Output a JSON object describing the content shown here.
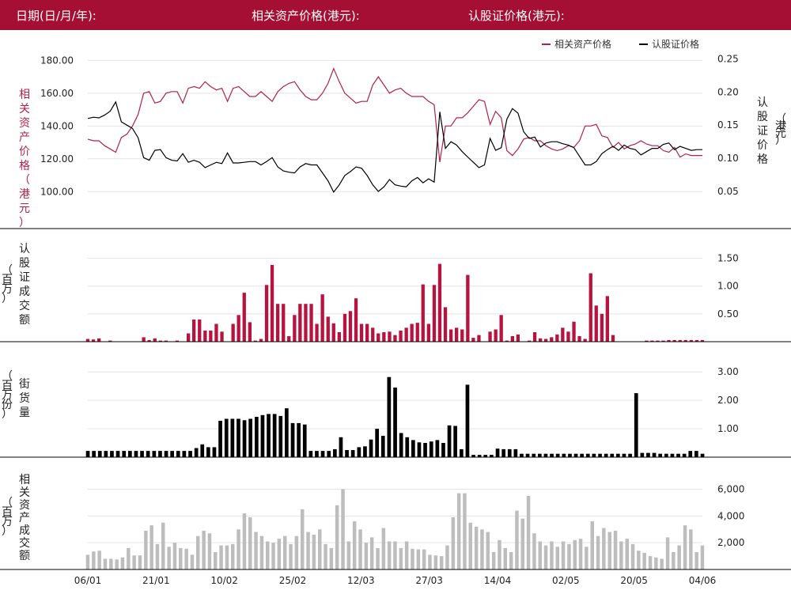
{
  "header": {
    "date_label": "日期(日/月/年):",
    "underlying_label": "相关资产价格(港元):",
    "warrant_label": "认股证价格(港元):"
  },
  "colors": {
    "brand": "#a50f33",
    "underlying": "#b0224a",
    "warrant": "#000000",
    "warrant_bar": "#b8123e",
    "outstanding_bar": "#000000",
    "turnover_bar": "#bdbdbd"
  },
  "chart_data": [
    {
      "type": "line",
      "x_tick_labels": [
        "06/01",
        "21/01",
        "10/02",
        "25/02",
        "12/03",
        "27/03",
        "14/04",
        "02/05",
        "20/05",
        "04/06"
      ],
      "left_axis_title": "相关资产价格（港元）",
      "right_axis_title": "认股证价格（港元）",
      "left_ticks": [
        "100.00",
        "120.00",
        "140.00",
        "160.00",
        "180.00"
      ],
      "right_ticks": [
        "0.05",
        "0.10",
        "0.15",
        "0.20",
        "0.25"
      ],
      "ylim_left": [
        90,
        185
      ],
      "ylim_right": [
        0.025,
        0.26
      ],
      "legend": [
        "相关资产价格",
        "认股证价格"
      ],
      "legend_position": "top-right",
      "grid": true,
      "series": [
        {
          "name": "相关资产价格",
          "axis": "left",
          "values": [
            132,
            131,
            131,
            128,
            126,
            124,
            133,
            135,
            140,
            147,
            160,
            161,
            154,
            155,
            160,
            161,
            161,
            154,
            163,
            164,
            163,
            167,
            164,
            162,
            163,
            155,
            163,
            164,
            161,
            158,
            158,
            161,
            158,
            155,
            161,
            164,
            166,
            167,
            162,
            158,
            156,
            156,
            160,
            166,
            175,
            167,
            160,
            157,
            154,
            155,
            155,
            165,
            170,
            165,
            160,
            162,
            163,
            160,
            158,
            158,
            158,
            155,
            153,
            118,
            140,
            140,
            145,
            145,
            148,
            152,
            156,
            155,
            141,
            149,
            145,
            125,
            122,
            126,
            132,
            133,
            131,
            131,
            128,
            126,
            125,
            126,
            128,
            127,
            131,
            140,
            140,
            141,
            134,
            133,
            127,
            130,
            126,
            128,
            129,
            131,
            129,
            128,
            128,
            125,
            124,
            127,
            121,
            123,
            122,
            122,
            122
          ]
        },
        {
          "name": "认股证价格",
          "axis": "right",
          "values": [
            0.16,
            0.162,
            0.161,
            0.165,
            0.171,
            0.185,
            0.155,
            0.15,
            0.145,
            0.131,
            0.101,
            0.097,
            0.112,
            0.113,
            0.101,
            0.097,
            0.096,
            0.107,
            0.094,
            0.097,
            0.094,
            0.086,
            0.09,
            0.094,
            0.092,
            0.108,
            0.093,
            0.093,
            0.094,
            0.095,
            0.095,
            0.09,
            0.095,
            0.101,
            0.087,
            0.081,
            0.079,
            0.078,
            0.087,
            0.092,
            0.09,
            0.09,
            0.078,
            0.066,
            0.049,
            0.06,
            0.074,
            0.08,
            0.087,
            0.085,
            0.074,
            0.06,
            0.05,
            0.057,
            0.068,
            0.06,
            0.058,
            0.057,
            0.066,
            0.071,
            0.063,
            0.069,
            0.064,
            0.17,
            0.115,
            0.125,
            0.12,
            0.11,
            0.102,
            0.094,
            0.086,
            0.09,
            0.13,
            0.112,
            0.116,
            0.159,
            0.175,
            0.168,
            0.14,
            0.13,
            0.132,
            0.117,
            0.123,
            0.125,
            0.125,
            0.122,
            0.12,
            0.116,
            0.103,
            0.09,
            0.09,
            0.095,
            0.107,
            0.113,
            0.118,
            0.112,
            0.12,
            0.115,
            0.113,
            0.105,
            0.11,
            0.115,
            0.115,
            0.121,
            0.123,
            0.113,
            0.118,
            0.115,
            0.112,
            0.113,
            0.113
          ]
        }
      ]
    },
    {
      "type": "bar",
      "y_axis_title": "认股证成交额（百万）",
      "right_ticks": [
        "0.50",
        "1.00",
        "1.50"
      ],
      "ylim": [
        0,
        1.65
      ],
      "values": [
        0.05,
        0.04,
        0.06,
        0,
        0.02,
        0,
        0,
        0,
        0,
        0,
        0.08,
        0.03,
        0.06,
        0.02,
        0.02,
        0,
        0.02,
        0,
        0.15,
        0.4,
        0.4,
        0.2,
        0.2,
        0.32,
        0.18,
        0,
        0.32,
        0.48,
        0.88,
        0.35,
        0.02,
        0.05,
        1.02,
        1.38,
        0.68,
        0.68,
        0.1,
        0.48,
        0.68,
        0.68,
        0.68,
        0.32,
        0.85,
        0.45,
        0.33,
        0.17,
        0.5,
        0.55,
        0.78,
        0.32,
        0.32,
        0.25,
        0.15,
        0.17,
        0.18,
        0.12,
        0.2,
        0.25,
        0.32,
        0.34,
        1.03,
        0.32,
        1.02,
        1.4,
        0.62,
        0.22,
        0.25,
        0.22,
        1.2,
        0.07,
        0.12,
        0,
        0.18,
        0.22,
        0.48,
        0.02,
        0.1,
        0.13,
        0,
        0.02,
        0.17,
        0.06,
        0.05,
        0.08,
        0.13,
        0.25,
        0.18,
        0.36,
        0.1,
        0.05,
        1.23,
        0.65,
        0.5,
        0.82,
        0.12,
        0,
        0,
        0,
        0,
        0,
        0.02,
        0.02,
        0.02,
        0.02,
        0.03,
        0.03,
        0.03,
        0.03,
        0.03,
        0.03,
        0.03
      ]
    },
    {
      "type": "bar",
      "y_axis_title": "街货量（百万份）",
      "right_ticks": [
        "1.00",
        "2.00",
        "3.00"
      ],
      "ylim": [
        0,
        3.2
      ],
      "values": [
        0.22,
        0.22,
        0.22,
        0.22,
        0.22,
        0.22,
        0.22,
        0.22,
        0.22,
        0.22,
        0.22,
        0.22,
        0.22,
        0.22,
        0.22,
        0.22,
        0.22,
        0.22,
        0.32,
        0.45,
        0.35,
        0.35,
        1.28,
        1.35,
        1.35,
        1.35,
        1.3,
        1.35,
        1.42,
        1.48,
        1.52,
        1.52,
        1.45,
        1.72,
        1.2,
        1.2,
        1.15,
        0.22,
        0.22,
        0.22,
        0.22,
        0.28,
        0.7,
        0.25,
        0.25,
        0.35,
        0.38,
        0.62,
        1.0,
        0.75,
        2.82,
        2.45,
        0.85,
        0.7,
        0.6,
        0.52,
        0.5,
        0.55,
        0.6,
        0.5,
        1.12,
        1.1,
        0.28,
        2.55,
        0.08,
        0.08,
        0.08,
        0.08,
        0.3,
        0.28,
        0.28,
        0.28,
        0.12,
        0.12,
        0.12,
        0.12,
        0.12,
        0.12,
        0.12,
        0.12,
        0.12,
        0.12,
        0.12,
        0.12,
        0.12,
        0.12,
        0.12,
        0.12,
        0.12,
        0.12,
        0.12,
        2.25,
        0.15,
        0.15,
        0.15,
        0.12,
        0.12,
        0.12,
        0.12,
        0.12,
        0.22,
        0.22,
        0.12
      ]
    },
    {
      "type": "bar",
      "y_axis_title": "相关资产成交额（百万）",
      "right_ticks": [
        "2,000",
        "4,000",
        "6,000"
      ],
      "ylim": [
        0,
        6800
      ],
      "values": [
        1100,
        1350,
        1400,
        800,
        800,
        750,
        900,
        1600,
        1050,
        1050,
        2900,
        3300,
        1900,
        3500,
        1700,
        2000,
        1600,
        1550,
        1100,
        2500,
        2900,
        2700,
        1300,
        1800,
        1800,
        1900,
        3000,
        4200,
        3900,
        2800,
        2500,
        2100,
        2000,
        2300,
        2500,
        1900,
        2500,
        4500,
        2800,
        2600,
        3000,
        1900,
        1600,
        4800,
        6000,
        2100,
        3600,
        3000,
        2000,
        2400,
        1600,
        3100,
        2100,
        2100,
        1600,
        2100,
        1550,
        1500,
        1500,
        1100,
        1050,
        1000,
        1800,
        3900,
        5700,
        5700,
        3500,
        3200,
        3000,
        2800,
        1300,
        2200,
        1600,
        1300,
        4400,
        3800,
        5500,
        2700,
        2100,
        1800,
        2100,
        1700,
        2100,
        1900,
        2200,
        2300,
        1700,
        3600,
        2500,
        3100,
        2800,
        2900,
        2100,
        2300,
        1900,
        1400,
        1250,
        1000,
        900,
        800,
        2400,
        1300,
        1800,
        3300,
        3000,
        1300,
        1800
      ]
    }
  ]
}
